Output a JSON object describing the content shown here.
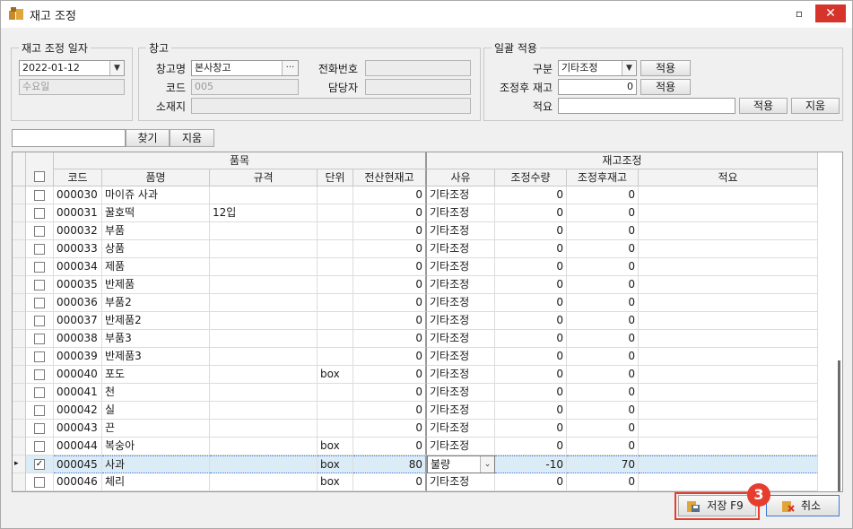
{
  "window": {
    "title": "재고 조정",
    "min_label": "▫",
    "close_label": "✕"
  },
  "adjust_date": {
    "legend": "재고 조정 일자",
    "date": "2022-01-12",
    "weekday": "수요일"
  },
  "warehouse": {
    "legend": "창고",
    "name_label": "창고명",
    "name_value": "본사창고",
    "browse_label": "···",
    "phone_label": "전화번호",
    "phone_value": "",
    "code_label": "코드",
    "code_value": "005",
    "manager_label": "담당자",
    "manager_value": "",
    "address_label": "소재지",
    "address_value": ""
  },
  "bulk": {
    "legend": "일괄 적용",
    "type_label": "구분",
    "type_value": "기타조정",
    "type_apply": "적용",
    "after_label": "조정후 재고",
    "after_value": "0",
    "after_apply": "적용",
    "note_label": "적요",
    "note_value": "",
    "note_apply": "적용",
    "note_clear": "지움"
  },
  "search": {
    "value": "",
    "find_label": "찾기",
    "clear_label": "지움"
  },
  "grid": {
    "group_item": "품목",
    "group_adjust": "재고조정",
    "headers": [
      "코드",
      "품명",
      "규격",
      "단위",
      "전산현재고",
      "사유",
      "조정수량",
      "조정후재고",
      "적요"
    ],
    "rows": [
      {
        "code": "000030",
        "name": "마이쥬 사과",
        "spec": "",
        "unit": "",
        "stock": "0",
        "reason": "기타조정",
        "qty": "0",
        "after": "0",
        "note": "",
        "checked": false,
        "selected": false
      },
      {
        "code": "000031",
        "name": "꿀호떡",
        "spec": "12입",
        "unit": "",
        "stock": "0",
        "reason": "기타조정",
        "qty": "0",
        "after": "0",
        "note": "",
        "checked": false,
        "selected": false
      },
      {
        "code": "000032",
        "name": "부품",
        "spec": "",
        "unit": "",
        "stock": "0",
        "reason": "기타조정",
        "qty": "0",
        "after": "0",
        "note": "",
        "checked": false,
        "selected": false
      },
      {
        "code": "000033",
        "name": "상품",
        "spec": "",
        "unit": "",
        "stock": "0",
        "reason": "기타조정",
        "qty": "0",
        "after": "0",
        "note": "",
        "checked": false,
        "selected": false
      },
      {
        "code": "000034",
        "name": "제품",
        "spec": "",
        "unit": "",
        "stock": "0",
        "reason": "기타조정",
        "qty": "0",
        "after": "0",
        "note": "",
        "checked": false,
        "selected": false
      },
      {
        "code": "000035",
        "name": "반제품",
        "spec": "",
        "unit": "",
        "stock": "0",
        "reason": "기타조정",
        "qty": "0",
        "after": "0",
        "note": "",
        "checked": false,
        "selected": false
      },
      {
        "code": "000036",
        "name": "부품2",
        "spec": "",
        "unit": "",
        "stock": "0",
        "reason": "기타조정",
        "qty": "0",
        "after": "0",
        "note": "",
        "checked": false,
        "selected": false
      },
      {
        "code": "000037",
        "name": "반제품2",
        "spec": "",
        "unit": "",
        "stock": "0",
        "reason": "기타조정",
        "qty": "0",
        "after": "0",
        "note": "",
        "checked": false,
        "selected": false
      },
      {
        "code": "000038",
        "name": "부품3",
        "spec": "",
        "unit": "",
        "stock": "0",
        "reason": "기타조정",
        "qty": "0",
        "after": "0",
        "note": "",
        "checked": false,
        "selected": false
      },
      {
        "code": "000039",
        "name": "반제품3",
        "spec": "",
        "unit": "",
        "stock": "0",
        "reason": "기타조정",
        "qty": "0",
        "after": "0",
        "note": "",
        "checked": false,
        "selected": false
      },
      {
        "code": "000040",
        "name": "포도",
        "spec": "",
        "unit": "box",
        "stock": "0",
        "reason": "기타조정",
        "qty": "0",
        "after": "0",
        "note": "",
        "checked": false,
        "selected": false
      },
      {
        "code": "000041",
        "name": "천",
        "spec": "",
        "unit": "",
        "stock": "0",
        "reason": "기타조정",
        "qty": "0",
        "after": "0",
        "note": "",
        "checked": false,
        "selected": false
      },
      {
        "code": "000042",
        "name": "실",
        "spec": "",
        "unit": "",
        "stock": "0",
        "reason": "기타조정",
        "qty": "0",
        "after": "0",
        "note": "",
        "checked": false,
        "selected": false
      },
      {
        "code": "000043",
        "name": "끈",
        "spec": "",
        "unit": "",
        "stock": "0",
        "reason": "기타조정",
        "qty": "0",
        "after": "0",
        "note": "",
        "checked": false,
        "selected": false
      },
      {
        "code": "000044",
        "name": "복숭아",
        "spec": "",
        "unit": "box",
        "stock": "0",
        "reason": "기타조정",
        "qty": "0",
        "after": "0",
        "note": "",
        "checked": false,
        "selected": false
      },
      {
        "code": "000045",
        "name": "사과",
        "spec": "",
        "unit": "box",
        "stock": "80",
        "reason": "불량",
        "qty": "-10",
        "after": "70",
        "note": "",
        "checked": true,
        "selected": true
      },
      {
        "code": "000046",
        "name": "체리",
        "spec": "",
        "unit": "box",
        "stock": "0",
        "reason": "기타조정",
        "qty": "0",
        "after": "0",
        "note": "",
        "checked": false,
        "selected": false
      }
    ]
  },
  "footer": {
    "save_label": "저장 F9",
    "cancel_label": "취소",
    "step_badge": "3"
  },
  "colors": {
    "accent_red": "#e63d2f",
    "selected_row": "#dcecf7"
  }
}
